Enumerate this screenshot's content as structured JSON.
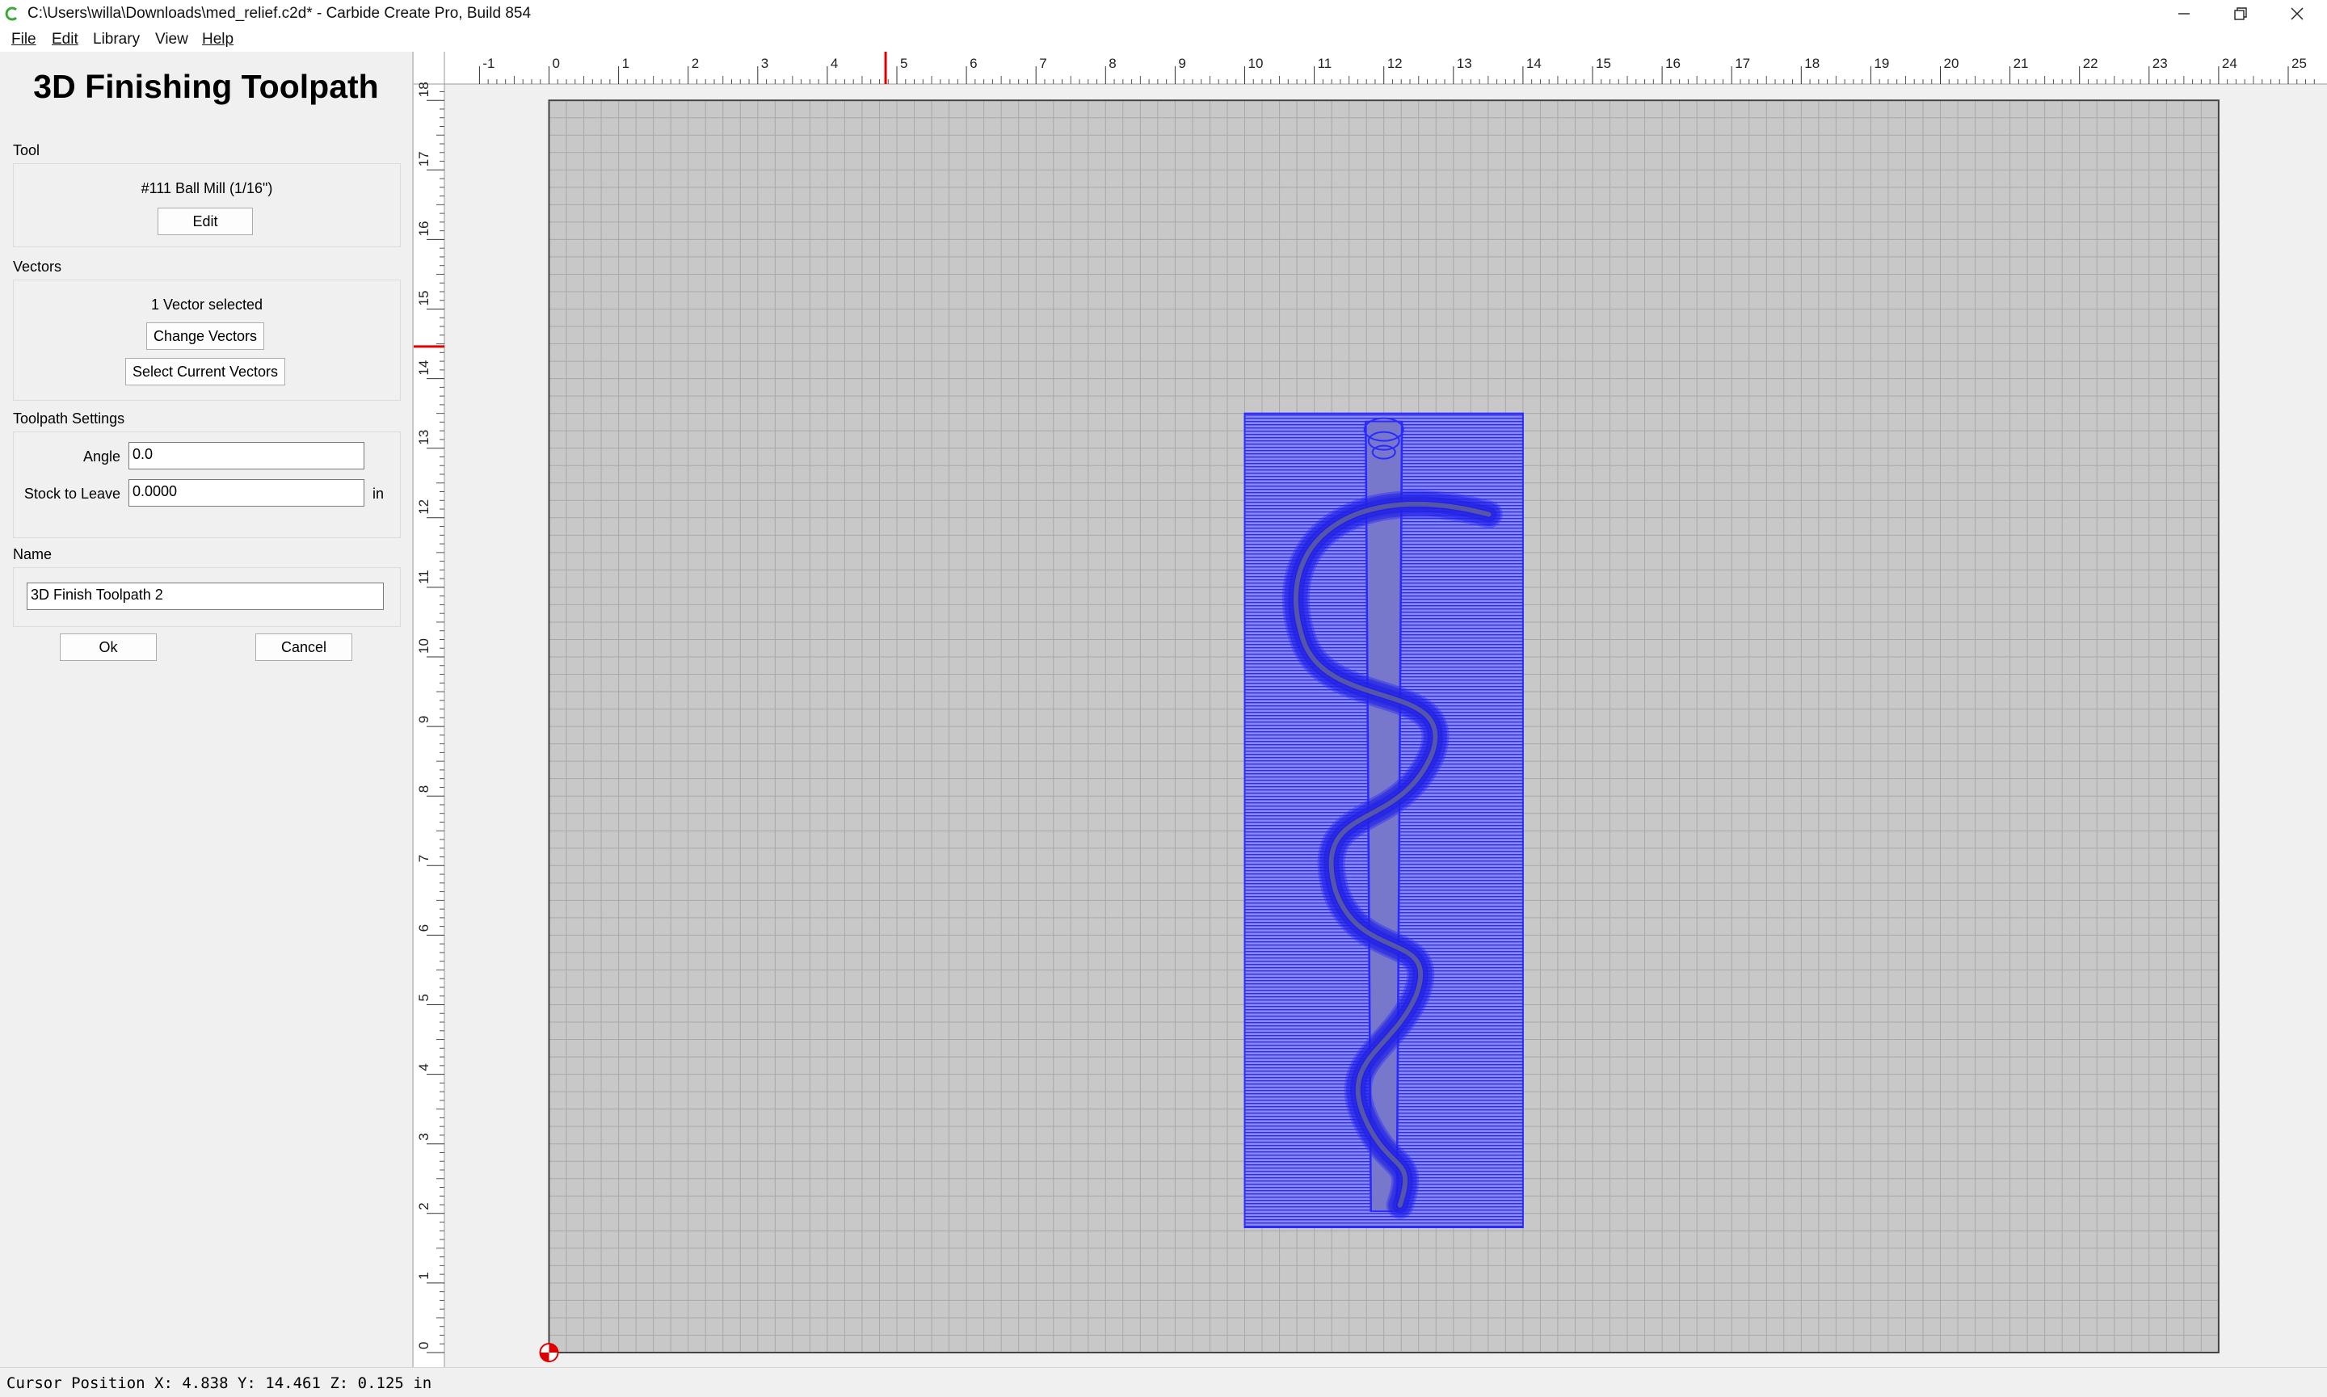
{
  "window": {
    "title": "C:\\Users\\willa\\Downloads\\med_relief.c2d* - Carbide Create Pro, Build 854",
    "minimize_icon": "minimize-icon",
    "restore_icon": "restore-icon",
    "close_icon": "close-icon"
  },
  "menu": [
    {
      "label": "File"
    },
    {
      "label": "Edit"
    },
    {
      "label": "Library"
    },
    {
      "label": "View"
    },
    {
      "label": "Help"
    }
  ],
  "panel": {
    "title": "3D Finishing Toolpath",
    "tool": {
      "section_label": "Tool",
      "tool_name": "#111 Ball Mill (1/16\")",
      "edit_label": "Edit"
    },
    "vectors": {
      "section_label": "Vectors",
      "status": "1 Vector selected",
      "change_label": "Change Vectors",
      "select_current_label": "Select Current Vectors"
    },
    "settings": {
      "section_label": "Toolpath Settings",
      "angle_label": "Angle",
      "angle_value": "0.0",
      "stock_label": "Stock to Leave",
      "stock_value": "0.0000",
      "stock_unit": "in"
    },
    "name": {
      "section_label": "Name",
      "value": "3D Finish Toolpath 2"
    },
    "ok_label": "Ok",
    "cancel_label": "Cancel"
  },
  "ruler": {
    "x_labels": [
      "-1",
      "0",
      "1",
      "2",
      "3",
      "4",
      "5",
      "6",
      "7",
      "8",
      "9",
      "10",
      "11",
      "12",
      "13",
      "14",
      "15",
      "16",
      "17",
      "18",
      "19",
      "20",
      "21",
      "22",
      "23",
      "24",
      "25"
    ],
    "y_labels": [
      "0",
      "1",
      "2",
      "3",
      "4",
      "5",
      "6",
      "7",
      "8",
      "9",
      "10",
      "11",
      "12",
      "13",
      "14",
      "15",
      "16",
      "17",
      "18"
    ],
    "cursor_x": 4.838,
    "cursor_y": 14.461,
    "marker_color": "#e00000"
  },
  "stock": {
    "width_in": 24,
    "height_in": 18,
    "grid_color": "#a8a8a8",
    "fill_color": "#c8c8c8"
  },
  "toolpath": {
    "x_range": [
      10,
      14
    ],
    "y_range": [
      1.8,
      13.5
    ],
    "color": "#2a2aff"
  },
  "status": {
    "text": "Cursor Position X: 4.838 Y: 14.461 Z: 0.125 in"
  }
}
